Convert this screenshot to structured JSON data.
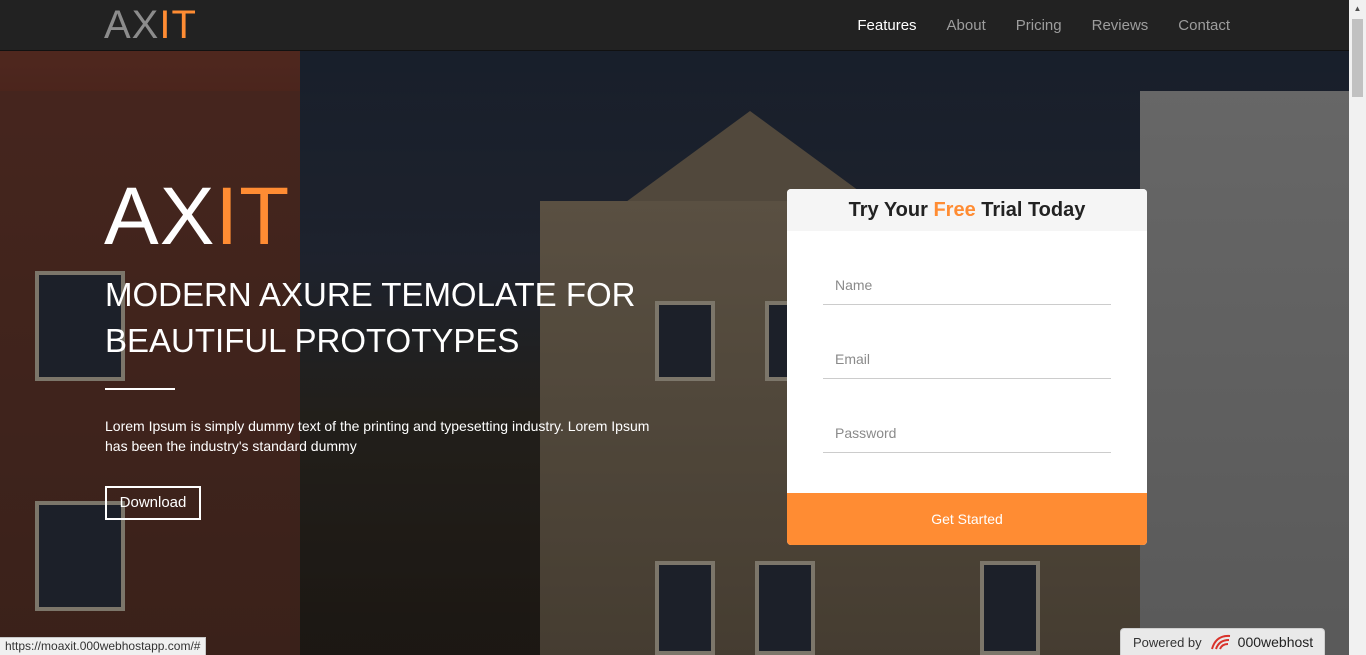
{
  "navbar": {
    "brand_part1": "AX",
    "brand_part2": "IT",
    "links": [
      {
        "label": "Features",
        "active": true
      },
      {
        "label": "About",
        "active": false
      },
      {
        "label": "Pricing",
        "active": false
      },
      {
        "label": "Reviews",
        "active": false
      },
      {
        "label": "Contact",
        "active": false
      }
    ]
  },
  "hero": {
    "title_part1": "AX",
    "title_part2": "IT",
    "subtitle": "MODERN AXURE TEMOLATE FOR BEAUTIFUL PROTOTYPES",
    "description": "Lorem Ipsum is simply dummy text of the printing and typesetting industry. Lorem Ipsum has been the industry's standard dummy",
    "download_label": "Download"
  },
  "trial_form": {
    "header_before": "Try Your ",
    "header_highlight": "Free",
    "header_after": " Trial Today",
    "name_placeholder": "Name",
    "email_placeholder": "Email",
    "password_placeholder": "Password",
    "submit_label": "Get Started"
  },
  "status_bar": {
    "url": "https://moaxit.000webhostapp.com/#"
  },
  "powered_badge": {
    "label": "Powered by",
    "host_name": "000webhost"
  },
  "colors": {
    "accent": "#ff8c33",
    "navbar_bg": "#222222"
  }
}
